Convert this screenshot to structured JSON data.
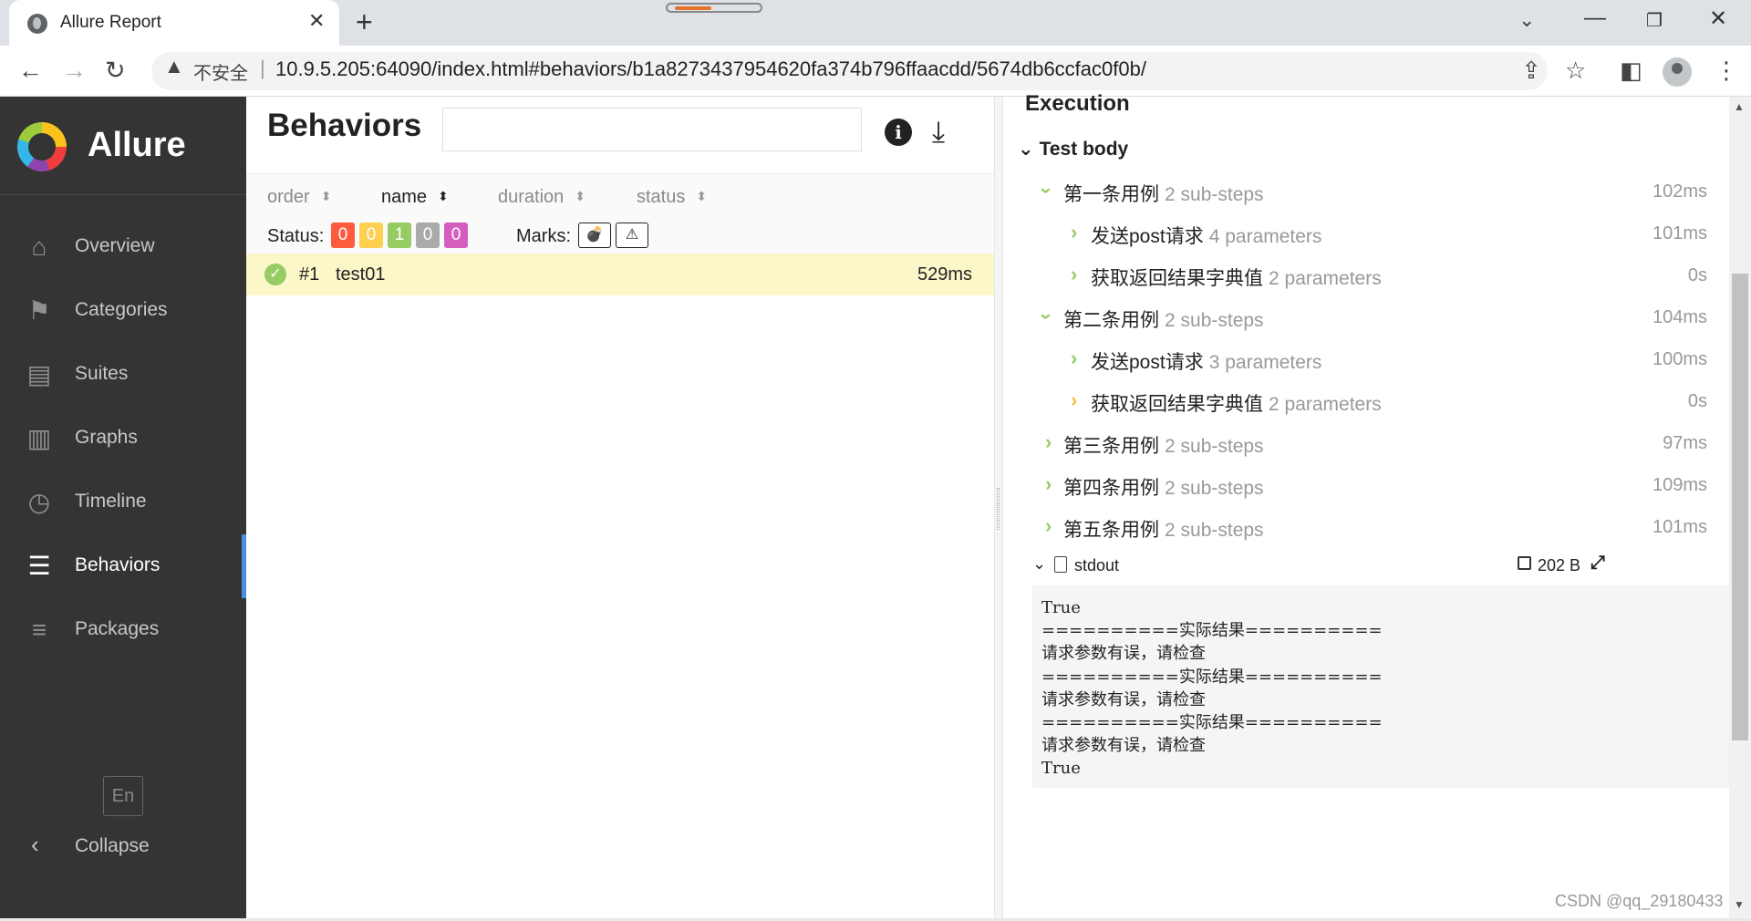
{
  "browser": {
    "tab_title": "Allure Report",
    "tab_close": "✕",
    "new_tab": "+",
    "insecure_label": "不安全",
    "separator": "|",
    "url": "10.9.5.205:64090/index.html#behaviors/b1a8273437954620fa374b796ffaacdd/5674db6ccfac0f0b/"
  },
  "sidebar": {
    "brand": "Allure",
    "items": [
      {
        "label": "Overview",
        "icon": "home-icon",
        "glyph": "⌂"
      },
      {
        "label": "Categories",
        "icon": "flag-icon",
        "glyph": "⚑"
      },
      {
        "label": "Suites",
        "icon": "briefcase-icon",
        "glyph": "▤"
      },
      {
        "label": "Graphs",
        "icon": "bar-chart-icon",
        "glyph": "▥"
      },
      {
        "label": "Timeline",
        "icon": "clock-icon",
        "glyph": "◷"
      },
      {
        "label": "Behaviors",
        "icon": "list-icon",
        "glyph": "☰",
        "active": true
      },
      {
        "label": "Packages",
        "icon": "align-left-icon",
        "glyph": "≡"
      }
    ],
    "language": "En",
    "collapse_label": "Collapse"
  },
  "behaviors": {
    "title": "Behaviors",
    "search_value": "",
    "columns": [
      {
        "label": "order",
        "sort_glyph": "⬍"
      },
      {
        "label": "name",
        "sort_glyph": "⬍"
      },
      {
        "label": "duration",
        "sort_glyph": "⬍"
      },
      {
        "label": "status",
        "sort_glyph": "⬍"
      }
    ],
    "status_label": "Status:",
    "status_counts": [
      {
        "value": "0",
        "color": "#fd5a3e",
        "status": "failed"
      },
      {
        "value": "0",
        "color": "#ffd050",
        "status": "broken"
      },
      {
        "value": "1",
        "color": "#97cc64",
        "status": "passed"
      },
      {
        "value": "0",
        "color": "#aaaaaa",
        "status": "skipped"
      },
      {
        "value": "0",
        "color": "#d35ebe",
        "status": "unknown"
      }
    ],
    "marks_label": "Marks:",
    "marks": [
      {
        "icon": "bomb-icon",
        "glyph": "💣"
      },
      {
        "icon": "warning-icon",
        "glyph": "⚠"
      }
    ],
    "tests": [
      {
        "num": "#1",
        "name": "test01",
        "duration": "529ms",
        "status": "passed"
      }
    ]
  },
  "execution": {
    "title": "Execution",
    "test_body_label": "Test body",
    "steps": [
      {
        "name": "第一条用例",
        "sub": "2 sub-steps",
        "duration": "102ms",
        "level": 0,
        "expanded": true,
        "status": "passed"
      },
      {
        "name": "发送post请求",
        "sub": "4 parameters",
        "duration": "101ms",
        "level": 1,
        "expanded": false,
        "status": "passed"
      },
      {
        "name": "获取返回结果字典值",
        "sub": "2 parameters",
        "duration": "0s",
        "level": 1,
        "expanded": false,
        "status": "passed"
      },
      {
        "name": "第二条用例",
        "sub": "2 sub-steps",
        "duration": "104ms",
        "level": 0,
        "expanded": true,
        "status": "passed"
      },
      {
        "name": "发送post请求",
        "sub": "3 parameters",
        "duration": "100ms",
        "level": 1,
        "expanded": false,
        "status": "passed"
      },
      {
        "name": "获取返回结果字典值",
        "sub": "2 parameters",
        "duration": "0s",
        "level": 1,
        "expanded": false,
        "status": "broken"
      },
      {
        "name": "第三条用例",
        "sub": "2 sub-steps",
        "duration": "97ms",
        "level": 0,
        "expanded": false,
        "status": "passed"
      },
      {
        "name": "第四条用例",
        "sub": "2 sub-steps",
        "duration": "109ms",
        "level": 0,
        "expanded": false,
        "status": "passed"
      },
      {
        "name": "第五条用例",
        "sub": "2 sub-steps",
        "duration": "101ms",
        "level": 0,
        "expanded": false,
        "status": "passed"
      }
    ],
    "attachment": {
      "name": "stdout",
      "size": "202 B",
      "content": "True\n==========实际结果==========\n请求参数有误，请检查\n==========实际结果==========\n请求参数有误，请检查\n==========实际结果==========\n请求参数有误，请检查\nTrue"
    }
  },
  "watermark": "CSDN @qq_29180433"
}
